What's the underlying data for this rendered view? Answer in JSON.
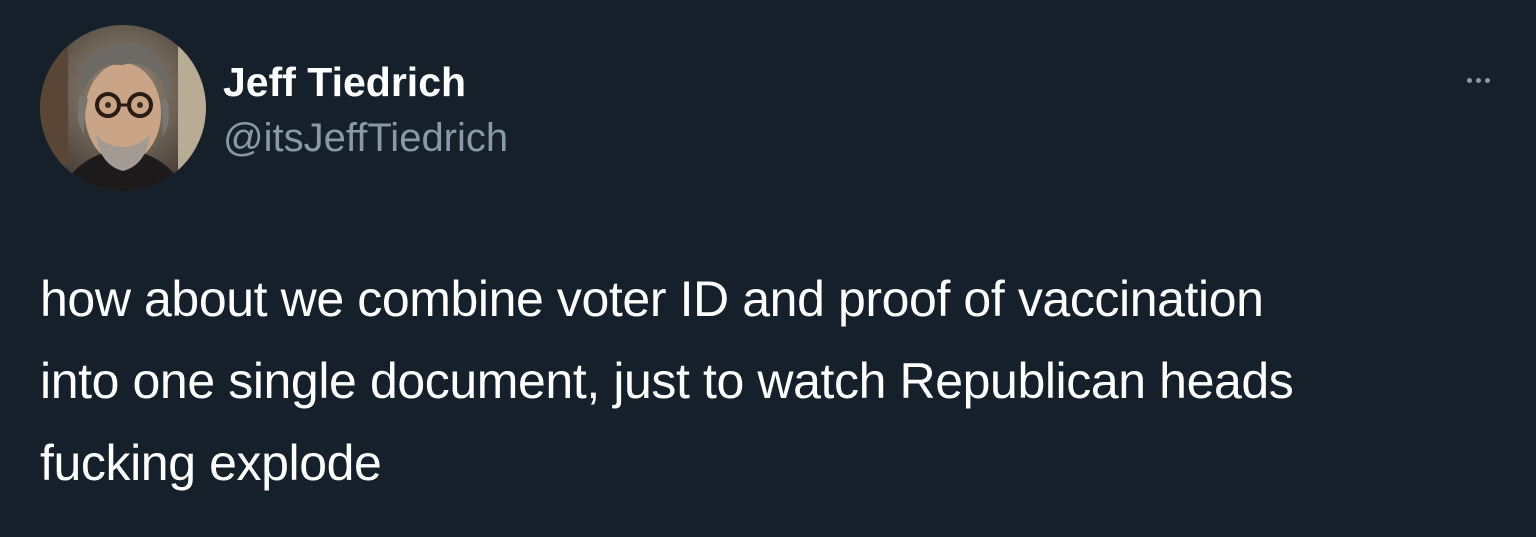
{
  "tweet": {
    "author": {
      "name": "Jeff Tiedrich",
      "handle": "@itsJeffTiedrich",
      "avatar_icon": "profile-photo"
    },
    "more_icon": "more-options-icon",
    "text_lines": [
      "how about we combine voter ID and proof of vaccination",
      "into one single document, just to watch Republican heads",
      "fucking explode"
    ]
  },
  "colors": {
    "background": "#15202b",
    "text_primary": "#ffffff",
    "text_secondary": "#8b98a5"
  }
}
